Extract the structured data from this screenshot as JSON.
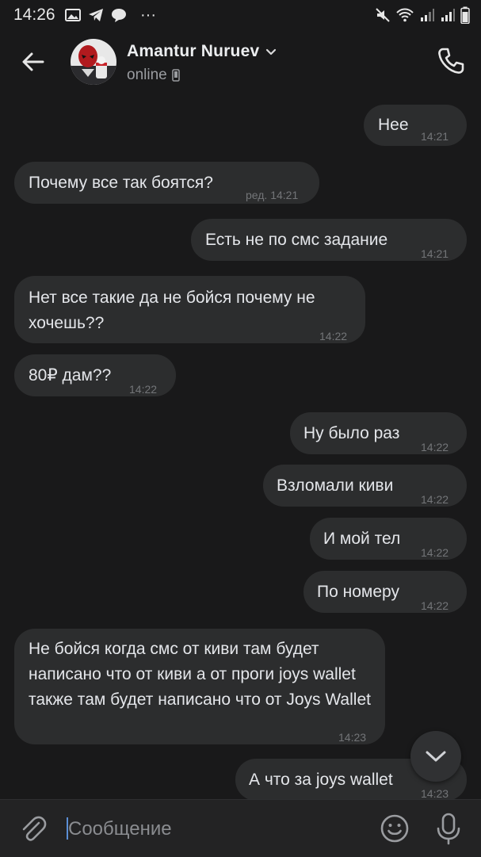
{
  "statusbar": {
    "time": "14:26",
    "left_icons": [
      "gallery-icon",
      "telegram-icon",
      "chat-icon",
      "more-icon"
    ],
    "right_icons": [
      "mute-icon",
      "wifi-icon",
      "signal-icon",
      "signal-icon",
      "battery-icon"
    ],
    "more_glyph": "···"
  },
  "header": {
    "name": "Amantur Nuruev",
    "status": "online",
    "back_icon": "back-arrow-icon",
    "call_icon": "phone-icon"
  },
  "messages": [
    {
      "dir": "out",
      "text": "Нее",
      "time": "14:21"
    },
    {
      "dir": "in",
      "text": "Почему все так боятся?",
      "time": "ред. 14:21"
    },
    {
      "dir": "out",
      "text": "Есть не по смс задание",
      "time": "14:21"
    },
    {
      "dir": "in",
      "text": "Нет все такие да не бойся почему не хочешь??",
      "time": "14:22"
    },
    {
      "dir": "in",
      "text": "80₽ дам??",
      "time": "14:22"
    },
    {
      "dir": "out",
      "text": "Ну было раз",
      "time": "14:22"
    },
    {
      "dir": "out",
      "text": "Взломали киви",
      "time": "14:22"
    },
    {
      "dir": "out",
      "text": "И мой тел",
      "time": "14:22"
    },
    {
      "dir": "out",
      "text": "По номеру",
      "time": "14:22"
    },
    {
      "dir": "in",
      "text": "Не бойся когда смс от киви там будет написано что от киви а от проги joys wallet также там будет написано что от Joys Wallet",
      "time": "14:23"
    },
    {
      "dir": "out",
      "text": "А что за joys wallet",
      "time": "14:23"
    }
  ],
  "composer": {
    "placeholder": "Сообщение",
    "attach_icon": "paperclip-icon",
    "emoji_icon": "emoji-icon",
    "mic_icon": "microphone-icon"
  },
  "colors": {
    "background": "#19191a",
    "bubble": "#2c2d2e",
    "text": "#e4e6ea",
    "muted": "#737578",
    "caret": "#5b8fd6"
  }
}
